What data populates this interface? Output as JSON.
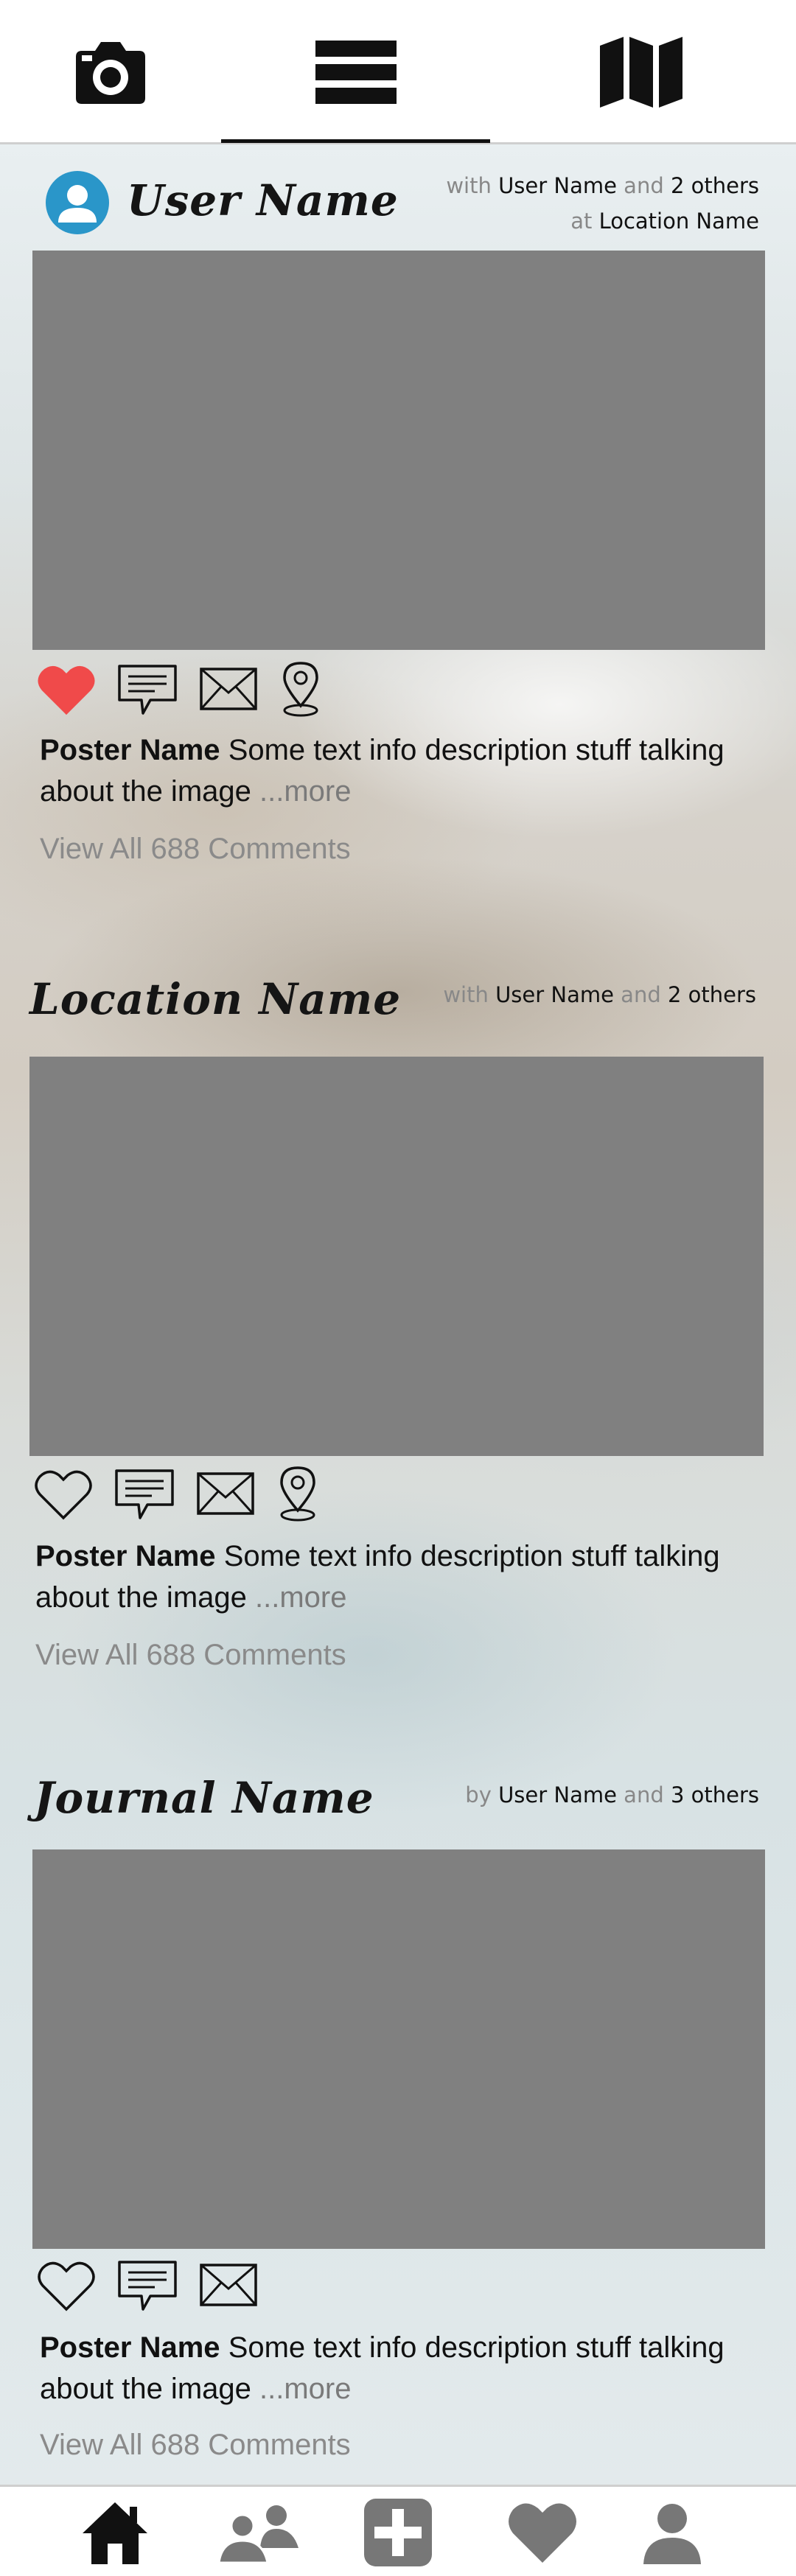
{
  "top_tabs": [
    {
      "icon": "camera-icon",
      "selected": false
    },
    {
      "icon": "feed-list-icon",
      "selected": true
    },
    {
      "icon": "map-icon",
      "selected": false
    }
  ],
  "posts": [
    {
      "kind": "user",
      "title": "User Name",
      "meta_line1": {
        "prefix": "with",
        "user": "User Name",
        "conj": "and",
        "count_text": "2 others"
      },
      "meta_line2": {
        "prefix": "at",
        "place": "Location Name"
      },
      "liked": true,
      "actions": [
        "heart-icon",
        "comment-icon",
        "mail-icon",
        "location-pin-icon"
      ],
      "poster": "Poster Name",
      "caption_text": "Some text info description stuff talking about the image",
      "more": "...more",
      "comments": "View All 688 Comments"
    },
    {
      "kind": "location",
      "title": "Location Name",
      "meta_line1": {
        "prefix": "with",
        "user": "User Name",
        "conj": "and",
        "count_text": "2 others"
      },
      "liked": false,
      "actions": [
        "heart-icon",
        "comment-icon",
        "mail-icon",
        "location-pin-icon"
      ],
      "poster": "Poster Name",
      "caption_text": "Some text info description stuff talking about the image",
      "more": "...more",
      "comments": "View All 688 Comments"
    },
    {
      "kind": "journal",
      "title": "Journal Name",
      "meta_line1": {
        "prefix": "by",
        "user": "User Name",
        "conj": "and",
        "count_text": "3 others"
      },
      "liked": false,
      "actions": [
        "heart-icon",
        "comment-icon",
        "mail-icon"
      ],
      "poster": "Poster Name",
      "caption_text": "Some text info description stuff talking about the image",
      "more": "...more",
      "comments": "View All 688 Comments"
    }
  ],
  "bottom_nav": [
    "home-icon",
    "friends-icon",
    "add-icon",
    "favorites-icon",
    "profile-icon"
  ],
  "colors": {
    "like_red": "#f04a4a",
    "avatar_blue": "#2a96c9",
    "photo_gray": "#808080",
    "nav_gray": "#777777"
  }
}
